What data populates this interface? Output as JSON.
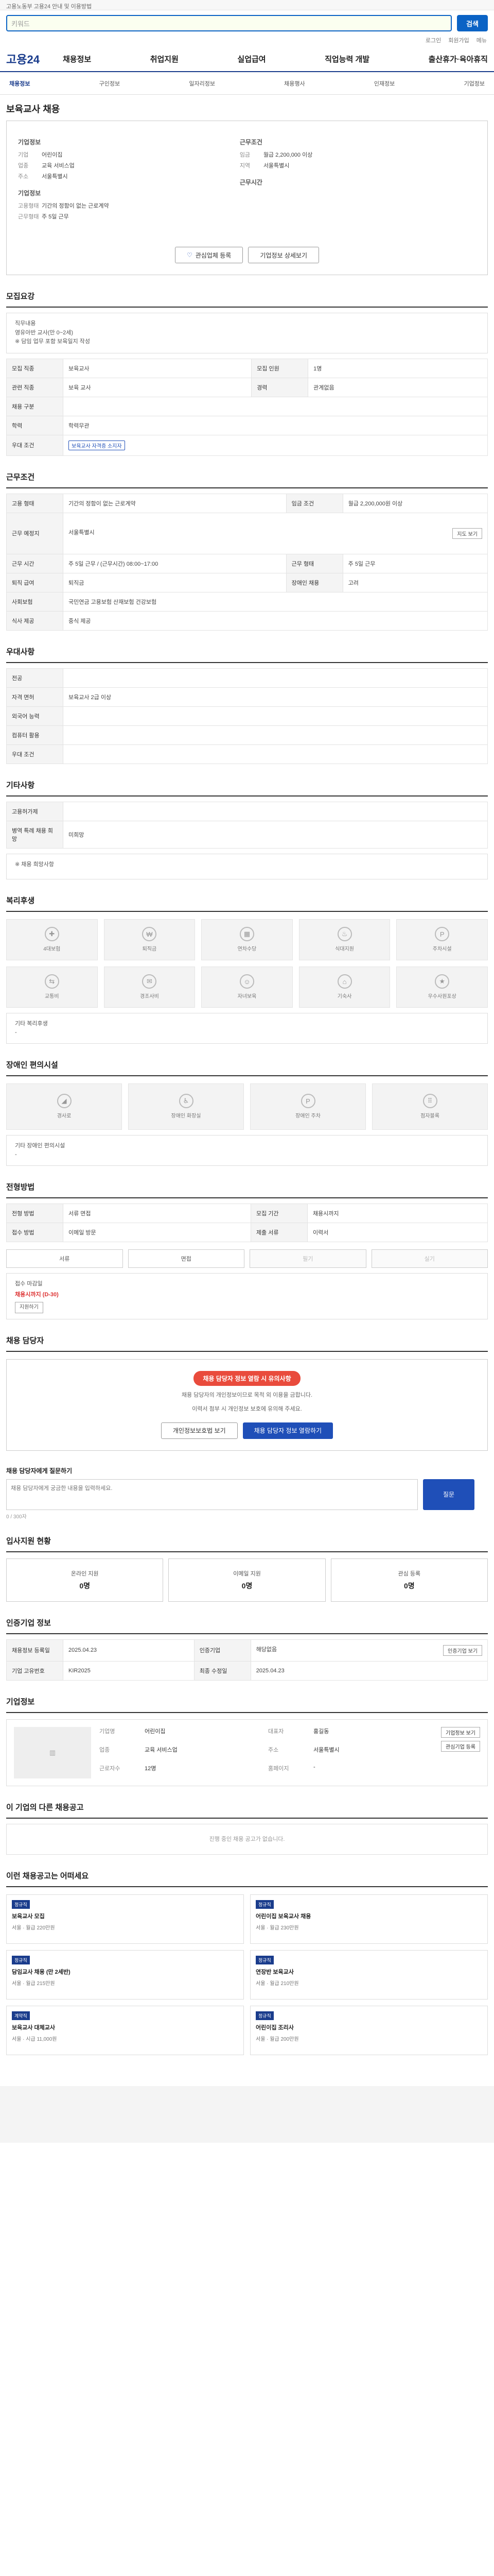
{
  "top": {
    "notice": "고용노동부 고용24 안내 및 이용방법",
    "search_placeholder": "키워드",
    "search_btn": "검색",
    "util": [
      "로그인",
      "회원가입",
      "메뉴"
    ]
  },
  "gnb": {
    "logo": "고용24",
    "menu": [
      "채용정보",
      "취업지원",
      "실업급여",
      "직업능력 개발",
      "출산휴가·육아휴직"
    ]
  },
  "lnb": [
    "채용정보",
    "구인정보",
    "일자리정보",
    "채용행사",
    "인재정보",
    "기업정보"
  ],
  "title": "보육교사 채용",
  "corp": {
    "label_left": "기업정보",
    "label_right": "근무조건",
    "label_mgr": "기업정보",
    "label_hours": "근무시간",
    "rows_left": [
      [
        "기업",
        "어린이집"
      ],
      [
        "업종",
        "교육 서비스업"
      ],
      [
        "주소",
        "서울특별시"
      ]
    ],
    "rows_right": [
      [
        "임금",
        "월급 2,200,000 이상"
      ],
      [
        "지역",
        "서울특별시"
      ]
    ],
    "rows_mgr": [
      [
        "고용형태",
        "기간의 정함이 없는 근로계약"
      ],
      [
        "근무형태",
        "주 5일 근무"
      ]
    ],
    "btn1": "관심업체 등록",
    "btn2": "기업정보 상세보기"
  },
  "sec_basic": {
    "title": "모집요강",
    "note": "직무내용\n영유아반 교사(만 0~2세)\n※ 담임 업무 포함 보육일지 작성",
    "rows": [
      [
        "모집 직종",
        "보육교사"
      ],
      [
        "관련 직종",
        "보육 교사"
      ],
      [
        "채용 구분",
        ""
      ],
      [
        "경력",
        "관계없음"
      ],
      [
        "학력",
        "학력무관"
      ],
      [
        "모집 인원",
        "1명"
      ],
      [
        "우대 조건",
        "보육교사 자격증 소지자"
      ]
    ]
  },
  "sec_cond": {
    "title": "근무조건",
    "rows": [
      [
        "고용 형태",
        "기간의 정함이 없는 근로계약"
      ],
      [
        "임금 조건",
        "월급 2,200,000원 이상"
      ],
      [
        "근무 예정지",
        "서울특별시"
      ],
      [
        "근무 시간",
        "주 5일 근무 / (근무시간) 08:00~17:00"
      ],
      [
        "퇴직 급여",
        "퇴직금"
      ],
      [
        "사회보험",
        "국민연금 고용보험 산재보험 건강보험"
      ],
      [
        "근무 형태",
        "주 5일 근무"
      ],
      [
        "장애인 채용",
        "고려"
      ],
      [
        "식사 제공",
        "중식 제공"
      ]
    ],
    "btn": "지도 보기"
  },
  "sec_pref": {
    "title": "우대사항",
    "rows": [
      [
        "전공",
        ""
      ],
      [
        "자격 면허",
        "보육교사 2급 이상"
      ],
      [
        "외국어 능력",
        ""
      ],
      [
        "컴퓨터 활용",
        ""
      ],
      [
        "우대 조건",
        ""
      ]
    ]
  },
  "sec_etc": {
    "title": "기타사항",
    "rows": [
      [
        "고용허가제",
        ""
      ],
      [
        "병역 특례 채용 희망",
        "미희망"
      ]
    ],
    "sub": "※ 채용 희망사항"
  },
  "sec_welfare": {
    "title": "복리후생",
    "items": [
      "4대보험",
      "퇴직금",
      "연차수당",
      "식대지원",
      "주차시설",
      "교통비",
      "경조사비",
      "자녀보육",
      "기숙사",
      "우수사원포상"
    ],
    "sub": "기타 복리후생",
    "empty": "-"
  },
  "sec_disable": {
    "title": "장애인 편의시설",
    "items": [
      "경사로",
      "장애인 화장실",
      "장애인 주차",
      "점자블록"
    ],
    "sub": "기타 장애인 편의시설",
    "empty": "-"
  },
  "sec_sel": {
    "title": "전형방법",
    "rows": [
      [
        "전형 방법",
        "서류 면접"
      ],
      [
        "모집 기간",
        "채용시까지"
      ],
      [
        "접수 방법",
        "이메일 방문"
      ],
      [
        "제출 서류",
        "이력서"
      ]
    ],
    "methods": [
      "서류",
      "면접",
      "필기",
      "실기"
    ],
    "label": "접수 마감일",
    "deadline": "채용시까지 (D-30)",
    "btn": "지원하기"
  },
  "sec_mgr": {
    "title": "채용 담당자",
    "alert": "채용 담당자 정보 열람 시 유의사항",
    "p1": "채용 담당자의 개인정보이므로 목적 외 이용을 금합니다.",
    "p2": "이력서 첨부 시 개인정보 보호에 유의해 주세요.",
    "btn1": "개인정보보호법 보기",
    "btn2": "채용 담당자 정보 열람하기"
  },
  "sec_q": {
    "title": "채용 담당자에게 질문하기",
    "placeholder": "채용 담당자에게 궁금한 내용을 입력하세요.",
    "submit": "질문",
    "counter": "0 / 300자"
  },
  "sec_stat": {
    "title": "입사지원 현황",
    "items": [
      [
        "온라인 지원",
        "0명"
      ],
      [
        "이메일 지원",
        "0명"
      ],
      [
        "관심 등록",
        "0명"
      ]
    ]
  },
  "sec_info": {
    "title": "인증기업 정보",
    "rows": [
      [
        "채용정보 등록일",
        "2025.04.23"
      ],
      [
        "인증기업",
        "해당없음"
      ],
      [
        "기업 고유번호",
        "KIR2025"
      ],
      [
        "최종 수정일",
        "2025.04.23"
      ]
    ],
    "btn": "인증기업 보기"
  },
  "sec_co": {
    "title": "기업정보",
    "rows": [
      [
        "기업명",
        "어린이집"
      ],
      [
        "업종",
        "교육 서비스업"
      ],
      [
        "근로자수",
        "12명"
      ],
      [
        "대표자",
        "홍길동"
      ],
      [
        "주소",
        "서울특별시"
      ],
      [
        "홈페이지",
        "-"
      ]
    ],
    "btn1": "기업정보 보기",
    "btn2": "관심기업 등록"
  },
  "sec_more": {
    "title": "이 기업의 다른 채용공고",
    "empty": "진행 중인 채용 공고가 없습니다."
  },
  "sec_rec": {
    "title": "이런 채용공고는 어떠세요",
    "items": [
      {
        "badge": "정규직",
        "title": "보육교사 모집",
        "meta": "서울 · 월급 220만원"
      },
      {
        "badge": "정규직",
        "title": "어린이집 보육교사 채용",
        "meta": "서울 · 월급 230만원"
      },
      {
        "badge": "정규직",
        "title": "담임교사 채용 (만 2세반)",
        "meta": "서울 · 월급 215만원"
      },
      {
        "badge": "정규직",
        "title": "연장반 보육교사",
        "meta": "서울 · 월급 210만원"
      },
      {
        "badge": "계약직",
        "title": "보육교사 대체교사",
        "meta": "서울 · 시급 11,000원"
      },
      {
        "badge": "정규직",
        "title": "어린이집 조리사",
        "meta": "서울 · 월급 200만원"
      }
    ]
  }
}
